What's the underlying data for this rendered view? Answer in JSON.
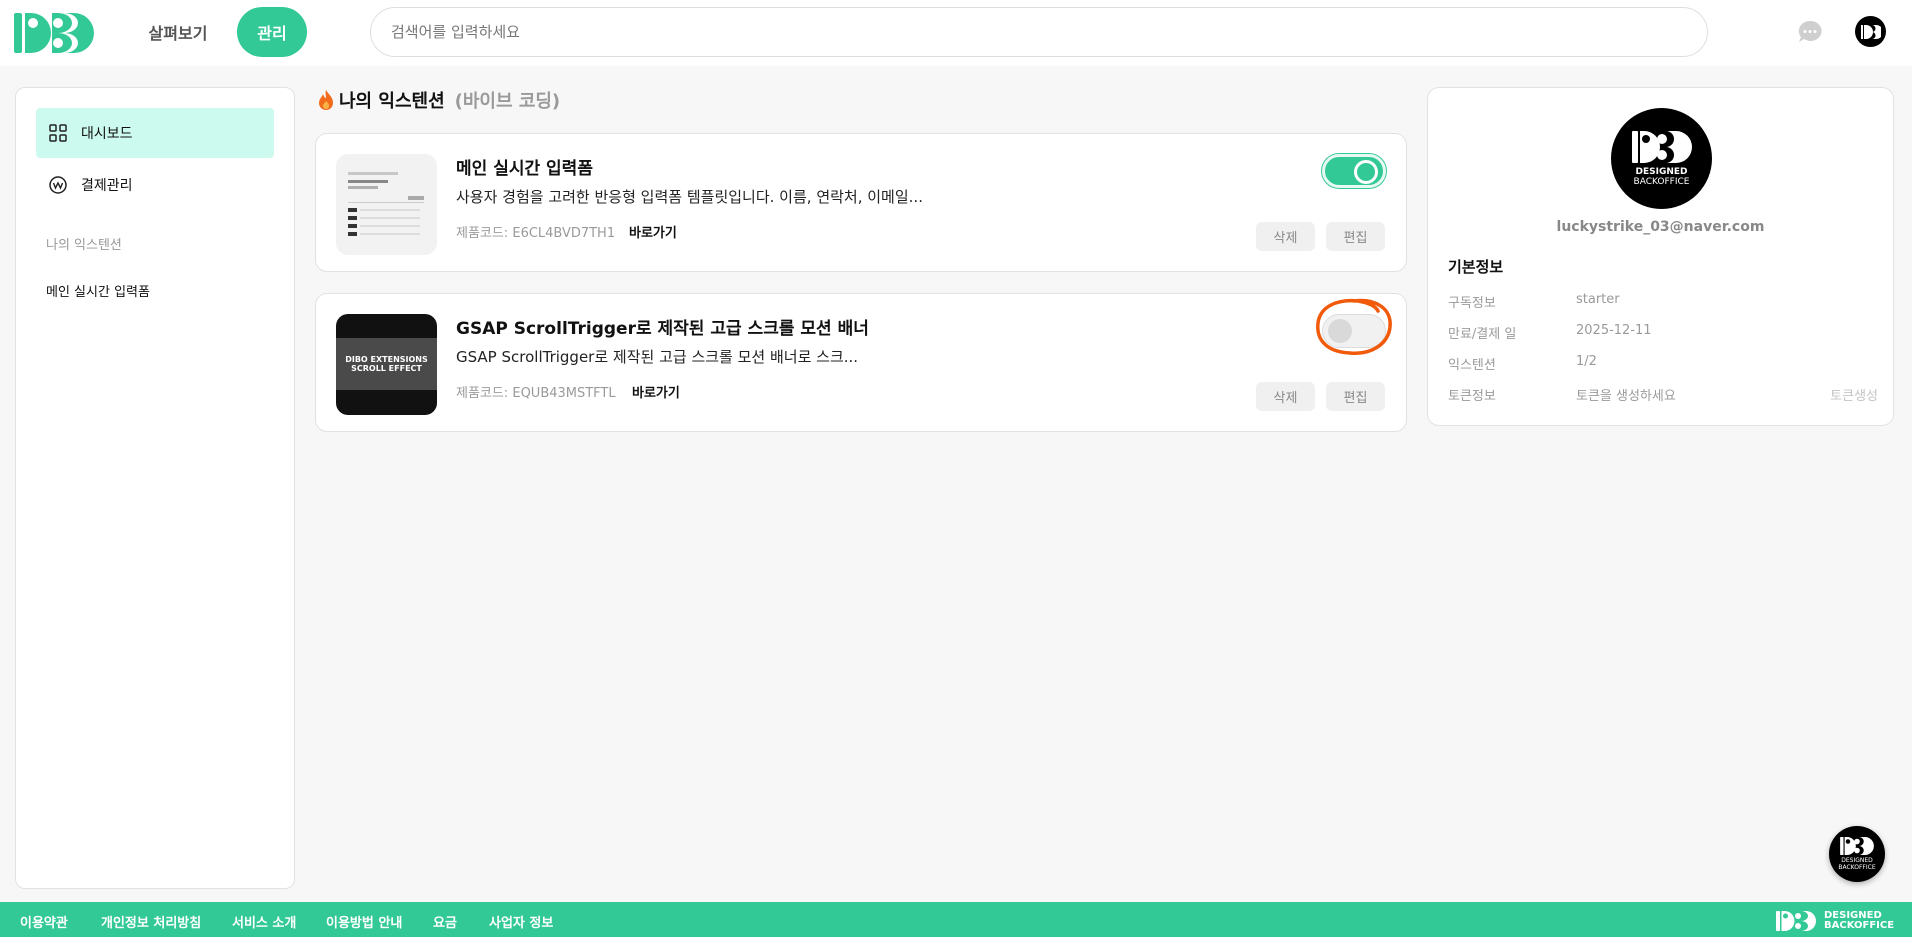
{
  "header": {
    "nav_browse": "살펴보기",
    "nav_manage": "관리",
    "search_placeholder": "검색어를 입력하세요"
  },
  "sidebar": {
    "items": [
      {
        "label": "대시보드",
        "icon": "grid-icon",
        "active": true
      },
      {
        "label": "결제관리",
        "icon": "payment-icon",
        "active": false
      }
    ],
    "section_label": "나의 익스텐션",
    "extensions": [
      {
        "label": "메인 실시간 입력폼"
      }
    ]
  },
  "main": {
    "title": "나의 익스텐션",
    "subtitle": "(바이브 코딩)",
    "cards": [
      {
        "title": "메인 실시간 입력폼",
        "description": "사용자 경험을 고려한 반응형 입력폼 템플릿입니다. 이름, 연락처, 이메일...",
        "code": "제품코드: E6CL4BVD7TH1",
        "link": "바로가기",
        "enabled": true,
        "delete_label": "삭제",
        "edit_label": "편집"
      },
      {
        "title": "GSAP ScrollTrigger로 제작된 고급 스크롤 모션 배너",
        "description": "GSAP ScrollTrigger로 제작된 고급 스크롤 모션 배너로 스크...",
        "code": "제품코드: EQUB43MSTFTL",
        "link": "바로가기",
        "enabled": false,
        "delete_label": "삭제",
        "edit_label": "편집",
        "thumb_line1": "DIBO EXTENSIONS",
        "thumb_line2": "SCROLL EFFECT"
      }
    ]
  },
  "profile": {
    "logo_line1": "DESIGNED",
    "logo_line2": "BACKOFFICE",
    "email": "luckystrike_03@naver.com",
    "section_title": "기본정보",
    "rows": [
      {
        "key": "구독정보",
        "value": "starter"
      },
      {
        "key": "만료/결제 일",
        "value": "2025-12-11"
      },
      {
        "key": "익스텐션",
        "value": "1/2"
      },
      {
        "key": "토큰정보",
        "value": "토큰을 생성하세요",
        "action": "토큰생성"
      }
    ]
  },
  "footer": {
    "links": [
      "이용약관",
      "개인정보 처리방침",
      "서비스 소개",
      "이용방법 안내",
      "요금",
      "사업자 정보"
    ],
    "brand_line1": "DESIGNED",
    "brand_line2": "BACKOFFICE"
  },
  "colors": {
    "accent": "#33c996",
    "active_bg": "#cdfaee",
    "highlight": "#f15a0a"
  }
}
